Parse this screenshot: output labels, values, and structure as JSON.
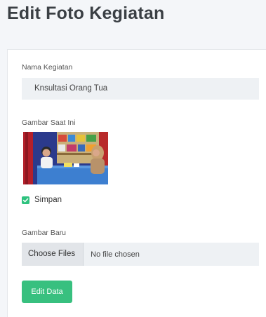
{
  "page": {
    "title": "Edit Foto Kegiatan"
  },
  "form": {
    "nama_label": "Nama Kegiatan",
    "nama_value": "Knsultasi Orang Tua",
    "gambar_saat_ini_label": "Gambar Saat Ini",
    "simpan_checkbox": {
      "label": "Simpan",
      "checked": true,
      "color": "#2ec27e"
    },
    "gambar_baru_label": "Gambar Baru",
    "file_input": {
      "button_label": "Choose Files",
      "status_text": "No file chosen"
    },
    "submit_label": "Edit Data",
    "accent_color": "#38c07f"
  }
}
